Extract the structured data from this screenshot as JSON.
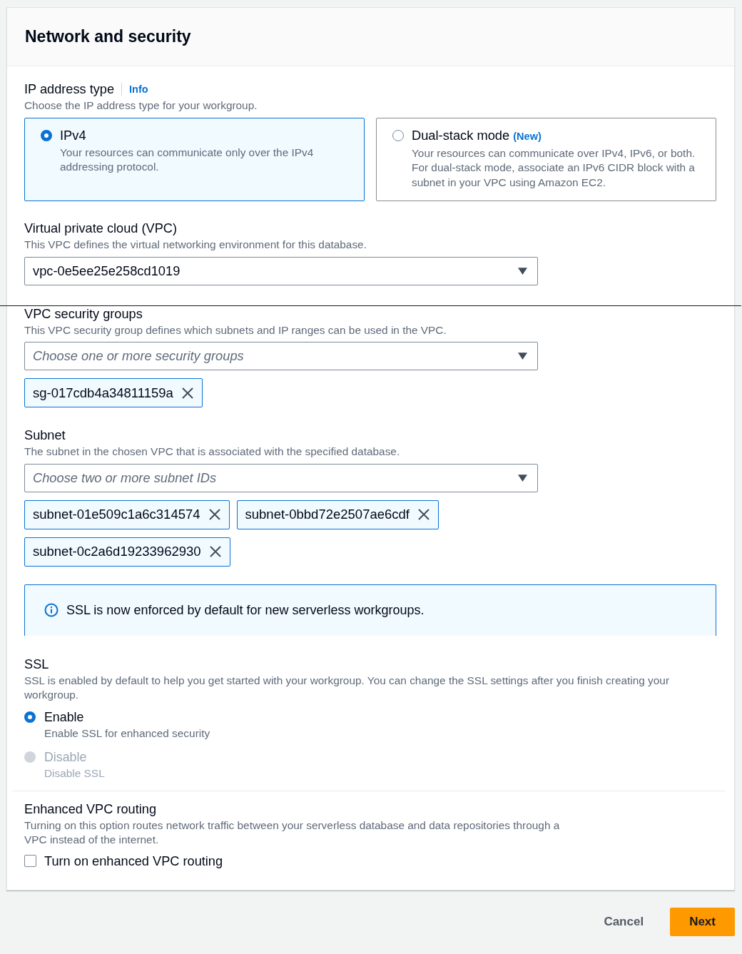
{
  "section": {
    "title": "Network and security"
  },
  "ip_address_type": {
    "label": "IP address type",
    "info_link": "Info",
    "description": "Choose the IP address type for your workgroup.",
    "options": [
      {
        "label": "IPv4",
        "description": "Your resources can communicate only over the IPv4 addressing protocol.",
        "selected": true
      },
      {
        "label": "Dual-stack mode",
        "tag": "(New)",
        "description": "Your resources can communicate over IPv4, IPv6, or both. For dual-stack mode, associate an IPv6 CIDR block with a subnet in your VPC using Amazon EC2.",
        "selected": false
      }
    ]
  },
  "vpc": {
    "label": "Virtual private cloud (VPC)",
    "description": "This VPC defines the virtual networking environment for this database.",
    "value": "vpc-0e5ee25e258cd1019"
  },
  "security_groups": {
    "label": "VPC security groups",
    "description": "This VPC security group defines which subnets and IP ranges can be used in the VPC.",
    "placeholder": "Choose one or more security groups",
    "tokens": [
      "sg-017cdb4a34811159a"
    ]
  },
  "subnet": {
    "label": "Subnet",
    "description": "The subnet in the chosen VPC that is associated with the specified database.",
    "placeholder": "Choose two or more subnet IDs",
    "tokens": [
      "subnet-01e509c1a6c314574",
      "subnet-0bbd72e2507ae6cdf",
      "subnet-0c2a6d19233962930"
    ]
  },
  "alert": {
    "text": "SSL is now enforced by default for new serverless workgroups."
  },
  "ssl": {
    "label": "SSL",
    "description": "SSL is enabled by default to help you get started with your workgroup. You can change the SSL settings after you finish creating your workgroup.",
    "options": [
      {
        "label": "Enable",
        "description": "Enable SSL for enhanced security",
        "selected": true,
        "disabled": false
      },
      {
        "label": "Disable",
        "description": "Disable SSL",
        "selected": false,
        "disabled": true
      }
    ]
  },
  "enhanced_vpc_routing": {
    "label": "Enhanced VPC routing",
    "description": "Turning on this option routes network traffic between your serverless database and data repositories through a VPC instead of the internet.",
    "checkbox": {
      "label": "Turn on enhanced VPC routing",
      "checked": false
    }
  },
  "footer": {
    "buttons": [
      {
        "label": "Cancel",
        "kind": "link"
      },
      {
        "label": "Next",
        "kind": "primary"
      }
    ]
  }
}
